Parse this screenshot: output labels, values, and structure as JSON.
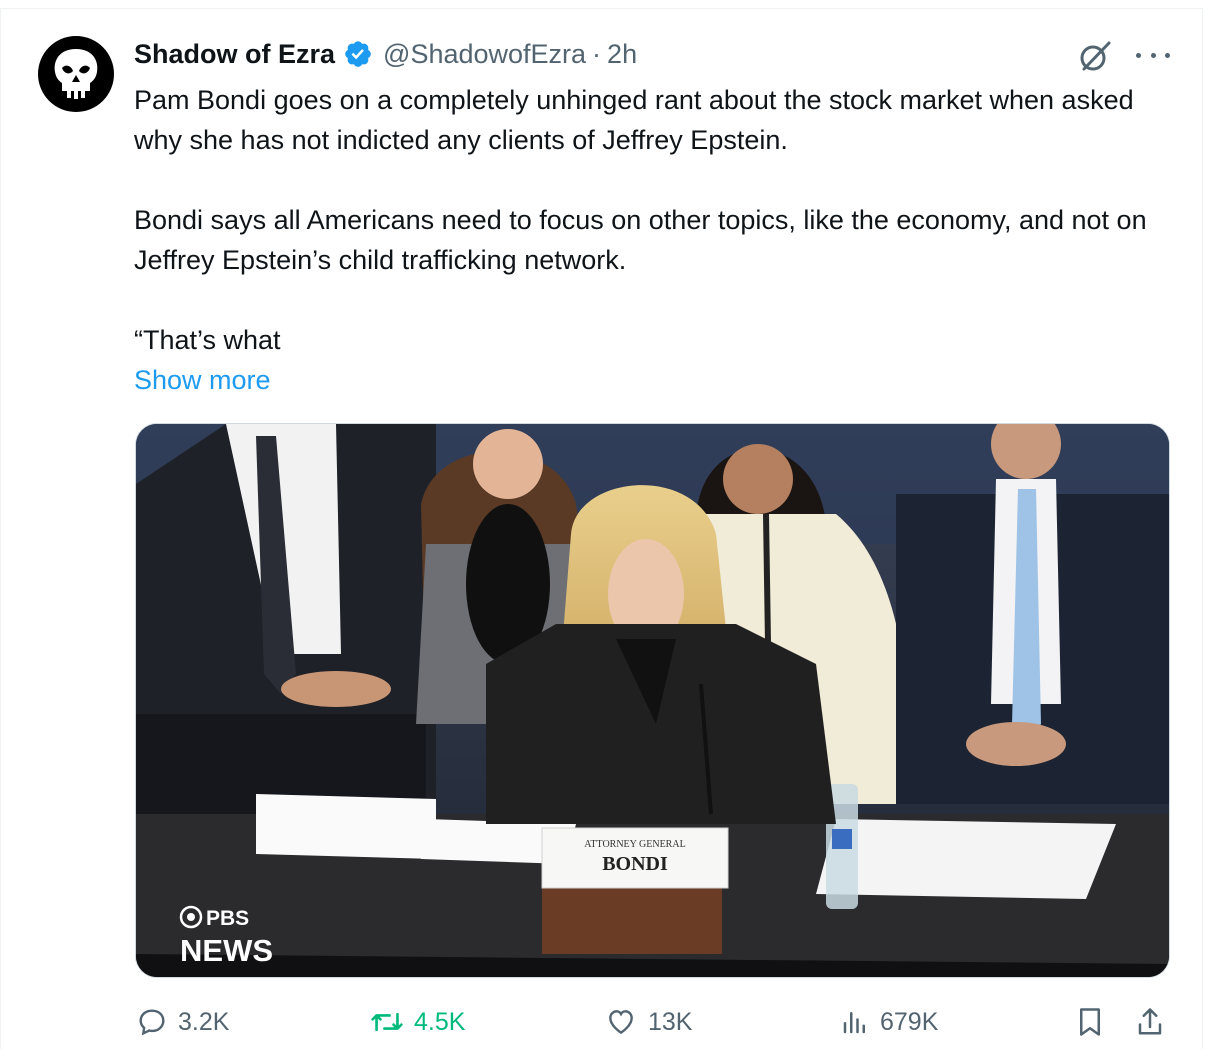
{
  "tweet": {
    "author_name": "Shadow of Ezra",
    "handle": "@ShadowofEzra",
    "separator": "·",
    "time": "2h",
    "paragraphs": [
      "Pam Bondi goes on a completely unhinged rant about the stock market when asked why she has not indicted any clients of Jeffrey Epstein.",
      "Bondi says all Americans need to focus on other topics, like the economy, and not on Jeffrey Epstein’s child trafficking network.",
      "“That’s what"
    ],
    "show_more": "Show more"
  },
  "media": {
    "nameplate_title": "ATTORNEY GENERAL",
    "nameplate_name": "BONDI",
    "watermark_top": "PBS",
    "watermark_bottom": "NEWS"
  },
  "actions": {
    "replies": "3.2K",
    "reposts": "4.5K",
    "likes": "13K",
    "views": "679K"
  },
  "icons": [
    "verified-badge-icon",
    "grok-icon",
    "more-icon",
    "reply-icon",
    "repost-icon",
    "like-icon",
    "views-icon",
    "bookmark-icon",
    "share-icon"
  ],
  "colors": {
    "accent": "#1d9bf0",
    "text": "#0f1419",
    "secondary": "#536471",
    "repost": "#00ba7c"
  }
}
